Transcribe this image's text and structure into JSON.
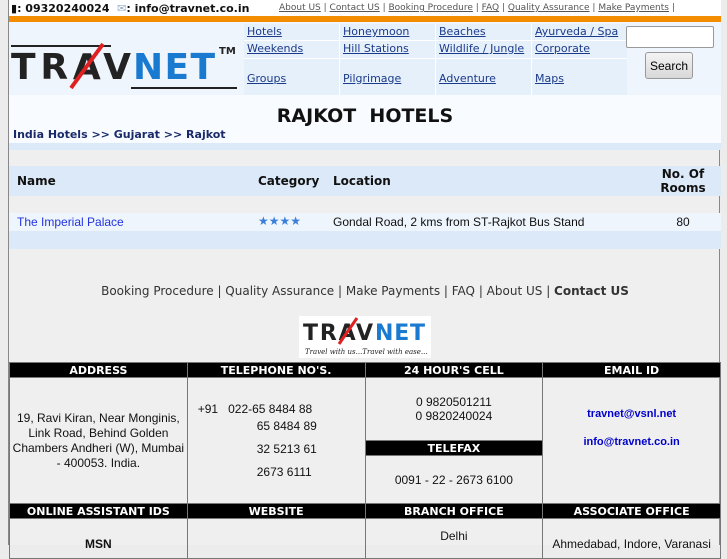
{
  "topbar": {
    "phone": "09320240024",
    "email": "info@travnet.co.in",
    "links": [
      "About US",
      "Contact US",
      "Booking Procedure",
      "FAQ",
      "Quality Assurance",
      "Make Payments"
    ]
  },
  "logo": {
    "text": "TRAVNET",
    "tm": "TM",
    "tagline": "Travel with us...Travel with ease..."
  },
  "nav": [
    "Hotels",
    "Honeymoon",
    "Beaches",
    "Ayurveda / Spa",
    "Weekends",
    "Hill Stations",
    "Wildlife / Jungle",
    "Corporate",
    "Groups",
    "Pilgrimage",
    "Adventure",
    "Maps"
  ],
  "search": {
    "value": "",
    "button": "Search"
  },
  "title": "RAJKOT  HOTELS",
  "breadcrumb": [
    "India Hotels",
    "Gujarat",
    "Rajkot"
  ],
  "breadcrumb_sep": ">>",
  "table": {
    "headers": [
      "Name",
      "Category",
      "Location",
      "No. Of Rooms"
    ],
    "rows": [
      {
        "name": "The Imperial Palace",
        "category": "★★★★",
        "stars": 4,
        "location": "Gondal Road, 2 kms from ST-Rajkot Bus Stand",
        "rooms": "80"
      }
    ]
  },
  "footer_links": [
    "Booking Procedure",
    "Quality Assurance",
    "Make Payments",
    "FAQ",
    "About US",
    "Contact US"
  ],
  "contact": {
    "headers1": [
      "ADDRESS",
      "TELEPHONE NO'S.",
      "24 HOUR'S CELL",
      "EMAIL ID"
    ],
    "address": "19, Ravi Kiran, Near Monginis, Link Road, Behind Golden Chambers Andheri (W), Mumbai - 400053. India.",
    "phones": [
      "+91   022-65 8484 88",
      "65 8484 89",
      "32 5213 61",
      "2673 6111"
    ],
    "cells": [
      "0 9820501211",
      "0 9820240024"
    ],
    "telefax_label": "TELEFAX",
    "telefax": "0091 - 22 - 2673 6100",
    "emails": [
      "travnet@vsnl.net",
      "info@travnet.co.in"
    ],
    "headers2": [
      "ONLINE ASSISTANT IDS",
      "WEBSITE",
      "BRANCH OFFICE",
      "ASSOCIATE OFFICE"
    ],
    "online": "MSN",
    "branch": "Delhi",
    "associate": "Ahmedabad, Indore, Varanasi"
  }
}
